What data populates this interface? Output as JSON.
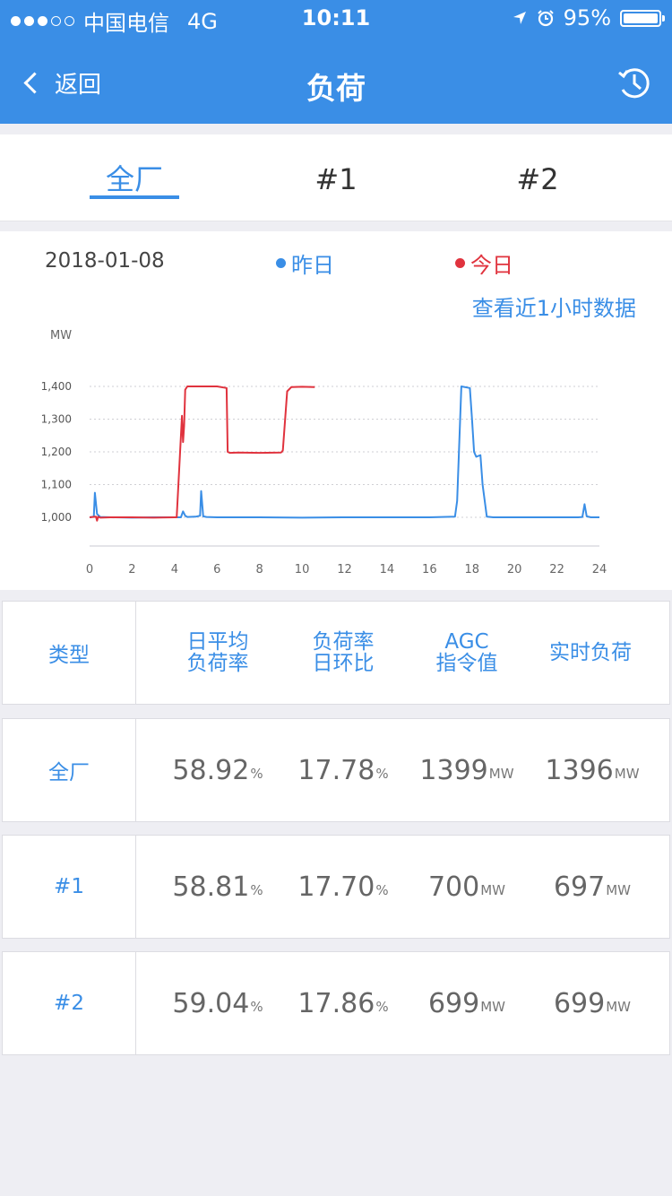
{
  "status_bar": {
    "carrier": "中国电信",
    "network": "4G",
    "time": "10:11",
    "battery": "95%"
  },
  "nav": {
    "back_label": "返回",
    "title": "负荷"
  },
  "tabs": [
    {
      "label": "全厂"
    },
    {
      "label": "#1"
    },
    {
      "label": "#2"
    }
  ],
  "chart_header": {
    "date": "2018-01-08",
    "legend": [
      {
        "label": "昨日",
        "color": "#3a8ee6"
      },
      {
        "label": "今日",
        "color": "#e0333e"
      }
    ],
    "link": "查看近1小时数据"
  },
  "chart_data": {
    "type": "line",
    "ylabel": "MW",
    "y_ticks": [
      "1,000",
      "1,100",
      "1,200",
      "1,300",
      "1,400"
    ],
    "x_ticks": [
      "0",
      "2",
      "4",
      "6",
      "8",
      "10",
      "12",
      "14",
      "16",
      "18",
      "20",
      "22",
      "24"
    ],
    "xlim": [
      0,
      24
    ],
    "ylim": [
      1000,
      1400
    ],
    "series": [
      {
        "name": "昨日",
        "color": "#3a8ee6",
        "x": [
          0,
          0.2,
          0.25,
          0.35,
          0.5,
          1,
          2,
          3,
          4,
          4.3,
          4.4,
          4.5,
          4.6,
          5,
          5.2,
          5.25,
          5.35,
          5.5,
          6,
          8,
          10,
          12,
          14,
          16,
          17.2,
          17.3,
          17.5,
          17.9,
          18.0,
          18.1,
          18.2,
          18.4,
          18.5,
          18.7,
          19,
          21,
          23,
          23.2,
          23.3,
          23.4,
          23.6,
          24
        ],
        "y": [
          1000,
          1002,
          1075,
          1010,
          1001,
          1000,
          999,
          1000,
          1000,
          1000,
          1018,
          1005,
          1001,
          1002,
          1005,
          1080,
          1003,
          1001,
          1000,
          1000,
          999,
          1000,
          1000,
          1000,
          1002,
          1050,
          1400,
          1395,
          1300,
          1200,
          1185,
          1190,
          1100,
          1002,
          1000,
          1000,
          1000,
          1001,
          1040,
          1003,
          1000,
          1000
        ]
      },
      {
        "name": "今日",
        "color": "#e0333e",
        "x": [
          0,
          0.3,
          0.35,
          0.4,
          0.5,
          1,
          2,
          3,
          4,
          4.1,
          4.35,
          4.4,
          4.45,
          4.5,
          4.6,
          5,
          6,
          6.45,
          6.5,
          6.6,
          7,
          8,
          9,
          9.05,
          9.1,
          9.3,
          9.5,
          10,
          10.6
        ],
        "y": [
          1000,
          1002,
          990,
          1002,
          999,
          1000,
          1000,
          999,
          1000,
          1000,
          1310,
          1230,
          1280,
          1390,
          1400,
          1400,
          1400,
          1395,
          1200,
          1197,
          1198,
          1197,
          1198,
          1200,
          1205,
          1385,
          1398,
          1399,
          1398
        ]
      }
    ]
  },
  "table": {
    "headers": [
      "类型",
      [
        "日平均",
        "负荷率"
      ],
      [
        "负荷率",
        "日环比"
      ],
      [
        "AGC",
        "指令值"
      ],
      "实时负荷"
    ],
    "rows": [
      {
        "type": "全厂",
        "avg_load_rate": "58.92",
        "avg_unit": "%",
        "ratio": "17.78",
        "ratio_unit": "%",
        "agc": "1399",
        "agc_unit": "MW",
        "realtime": "1396",
        "realtime_unit": "MW"
      },
      {
        "type": "#1",
        "avg_load_rate": "58.81",
        "avg_unit": "%",
        "ratio": "17.70",
        "ratio_unit": "%",
        "agc": "700",
        "agc_unit": "MW",
        "realtime": "697",
        "realtime_unit": "MW"
      },
      {
        "type": "#2",
        "avg_load_rate": "59.04",
        "avg_unit": "%",
        "ratio": "17.86",
        "ratio_unit": "%",
        "agc": "699",
        "agc_unit": "MW",
        "realtime": "699",
        "realtime_unit": "MW"
      }
    ]
  }
}
